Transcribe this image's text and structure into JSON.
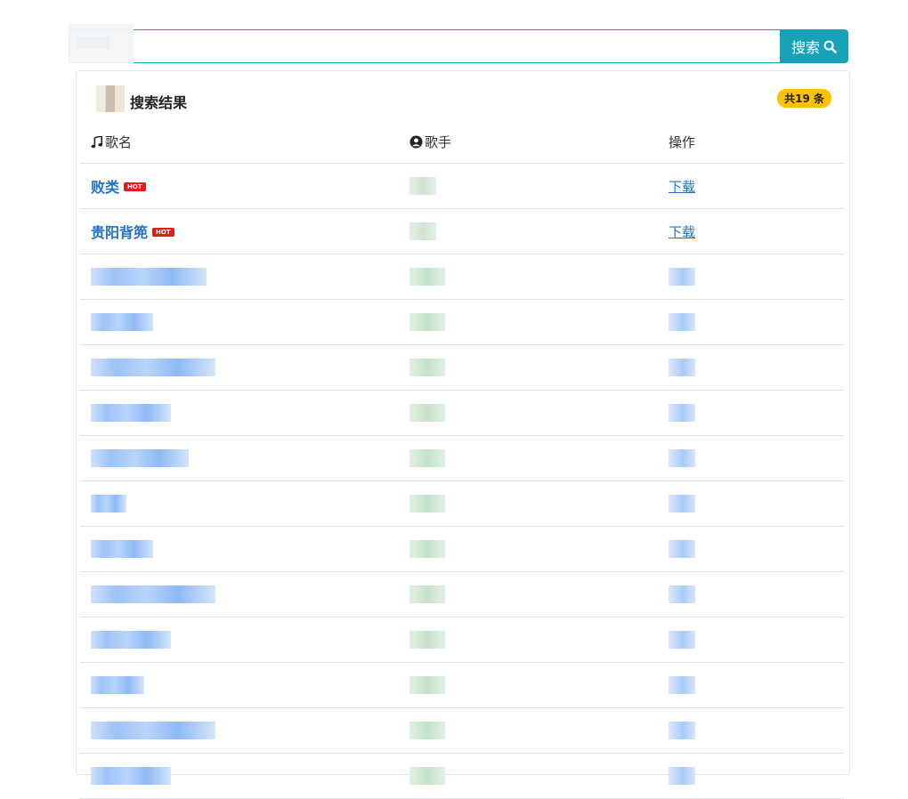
{
  "search": {
    "value": "",
    "button_label": "搜索",
    "placeholder": ""
  },
  "results": {
    "title": "搜索结果",
    "count_badge": "共19 条",
    "headers": {
      "song": "歌名",
      "artist": "歌手",
      "action": "操作"
    },
    "hot_label": "HOT",
    "rows": [
      {
        "song": "败类",
        "hot": true,
        "artist": "",
        "action": "下载"
      },
      {
        "song": "贵阳背篼",
        "hot": true,
        "artist": "",
        "action": "下载"
      }
    ]
  },
  "colors": {
    "accent": "#17a2b8",
    "badge": "#ffc107",
    "link": "#1d74c9",
    "hot": "#e21b1b"
  }
}
